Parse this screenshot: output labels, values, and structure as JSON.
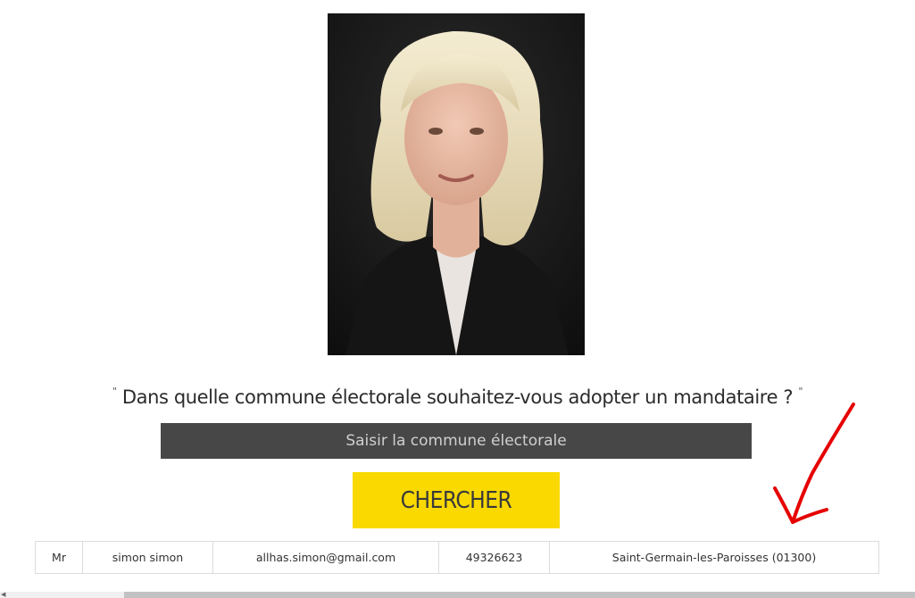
{
  "question": {
    "open_quote": "\"",
    "text": "Dans quelle commune électorale souhaitez-vous adopter un mandataire ?",
    "close_quote": "\""
  },
  "search": {
    "placeholder": "Saisir la commune électorale",
    "button_label": "CHERCHER"
  },
  "results": {
    "rows": [
      {
        "civility": "Mr",
        "name": "simon simon",
        "email": "allhas.simon@gmail.com",
        "number": "49326623",
        "commune": "Saint-Germain-les-Paroisses (01300)"
      }
    ]
  },
  "colors": {
    "button_bg": "#f9d900",
    "input_bg": "#474747",
    "annotation": "#e60000"
  },
  "icons": {
    "annotation": "red-arrow-icon",
    "scroll_left": "scroll-left-arrow-icon"
  }
}
